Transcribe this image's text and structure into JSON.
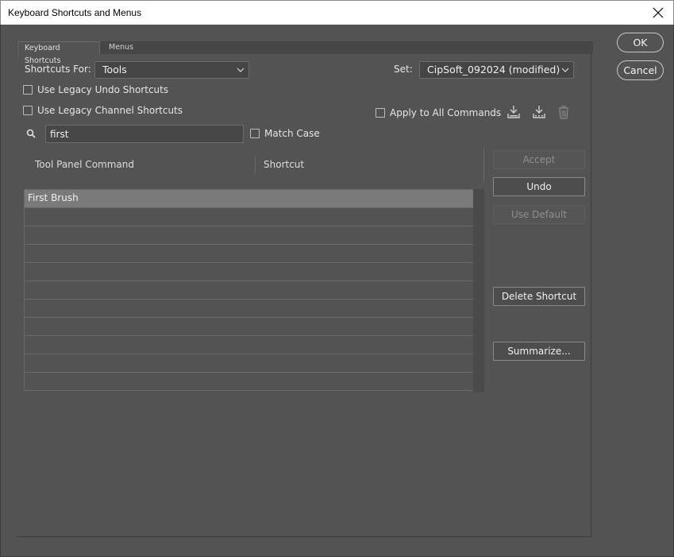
{
  "window": {
    "title": "Keyboard Shortcuts and Menus"
  },
  "tabs": [
    {
      "label": "Keyboard Shortcuts"
    },
    {
      "label": "Menus"
    }
  ],
  "shortcuts_for": {
    "label": "Shortcuts For:",
    "value": "Tools"
  },
  "set": {
    "label": "Set:",
    "value": "CipSoft_092024 (modified)"
  },
  "options": {
    "legacy_undo": {
      "label": "Use Legacy Undo Shortcuts",
      "checked": false
    },
    "legacy_channel": {
      "label": "Use Legacy Channel Shortcuts",
      "checked": false
    },
    "apply_all": {
      "label": "Apply to All Commands",
      "checked": false
    },
    "match_case": {
      "label": "Match Case",
      "checked": false
    }
  },
  "search": {
    "value": "first",
    "icon": "search-icon"
  },
  "set_icons": [
    "save-set-icon",
    "save-as-new-set-icon",
    "delete-set-icon"
  ],
  "table": {
    "col1": "Tool Panel Command",
    "col2": "Shortcut",
    "rows": [
      {
        "command": "First Brush",
        "shortcut": ""
      }
    ]
  },
  "buttons": {
    "accept": "Accept",
    "undo": "Undo",
    "use_default": "Use Default",
    "delete_shortcut": "Delete Shortcut",
    "summarize": "Summarize...",
    "ok": "OK",
    "cancel": "Cancel"
  },
  "colors": {
    "background": "#535353",
    "selected_row": "#7a7a7a"
  }
}
